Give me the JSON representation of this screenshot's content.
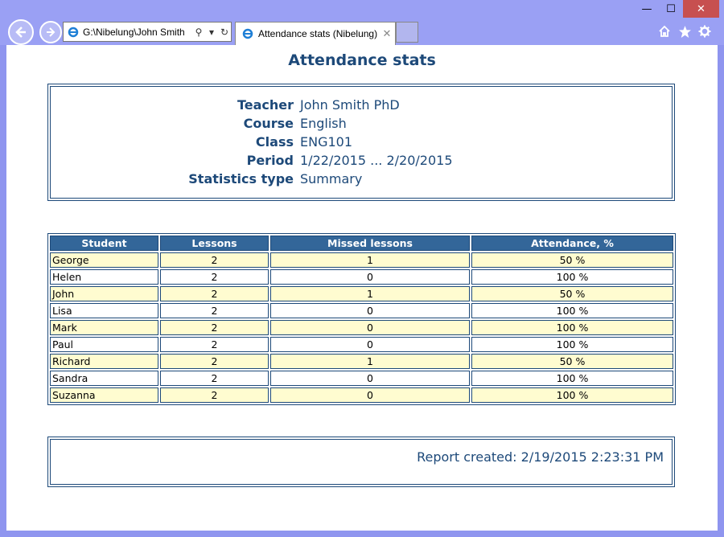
{
  "browser": {
    "address": "G:\\Nibelung\\John Smith",
    "tab_title": "Attendance stats (Nibelung)",
    "window_buttons": {
      "minimize": "—",
      "maximize": "☐",
      "close": "✕"
    },
    "icons": [
      "back-icon",
      "forward-icon",
      "ie-icon",
      "search-icon",
      "dropdown-icon",
      "refresh-icon",
      "close-tab-icon",
      "home-icon",
      "star-icon",
      "gear-icon"
    ]
  },
  "page": {
    "title": "Attendance stats",
    "info": [
      {
        "label": "Teacher",
        "value": "John Smith PhD"
      },
      {
        "label": "Course",
        "value": "English"
      },
      {
        "label": "Class",
        "value": "ENG101"
      },
      {
        "label": "Period",
        "value": "1/22/2015 ... 2/20/2015"
      },
      {
        "label": "Statistics type",
        "value": "Summary"
      }
    ],
    "table": {
      "headers": [
        "Student",
        "Lessons",
        "Missed lessons",
        "Attendance, %"
      ],
      "rows": [
        [
          "George",
          "2",
          "1",
          "50 %"
        ],
        [
          "Helen",
          "2",
          "0",
          "100 %"
        ],
        [
          "John",
          "2",
          "1",
          "50 %"
        ],
        [
          "Lisa",
          "2",
          "0",
          "100 %"
        ],
        [
          "Mark",
          "2",
          "0",
          "100 %"
        ],
        [
          "Paul",
          "2",
          "0",
          "100 %"
        ],
        [
          "Richard",
          "2",
          "1",
          "50 %"
        ],
        [
          "Sandra",
          "2",
          "0",
          "100 %"
        ],
        [
          "Suzanna",
          "2",
          "0",
          "100 %"
        ]
      ]
    },
    "report_created": "Report created: 2/19/2015 2:23:31 PM"
  },
  "colors": {
    "accent": "#1d4979",
    "header_bg": "#336699",
    "odd_row": "#fffcd0",
    "frame": "#9aa0f4"
  }
}
